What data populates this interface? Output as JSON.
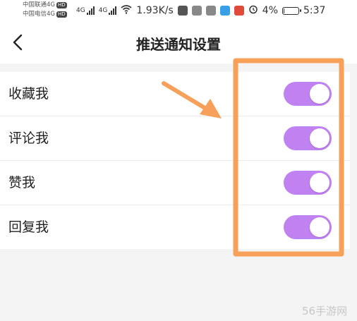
{
  "status_bar": {
    "carrier_1": "中国联通4G",
    "carrier_2": "中国电信4G",
    "hd_badge": "HD",
    "network_type": "4G",
    "net_speed": "1.93K/s",
    "battery_percent": "4%",
    "battery_level": 0.04,
    "time": "5:37",
    "icons": [
      "signal-icon",
      "wifi-icon",
      "app-notification-icons",
      "alarm-icon",
      "battery-icon"
    ]
  },
  "header": {
    "back_icon": "chevron-left-icon",
    "title": "推送通知设置"
  },
  "settings": [
    {
      "label": "收藏我",
      "enabled": true
    },
    {
      "label": "评论我",
      "enabled": true
    },
    {
      "label": "赞我",
      "enabled": true
    },
    {
      "label": "回复我",
      "enabled": true
    }
  ],
  "colors": {
    "toggle_on": "#bf82f0",
    "annotation": "#f6a05a",
    "background": "#f4f4f4"
  },
  "watermark": "56手游网"
}
